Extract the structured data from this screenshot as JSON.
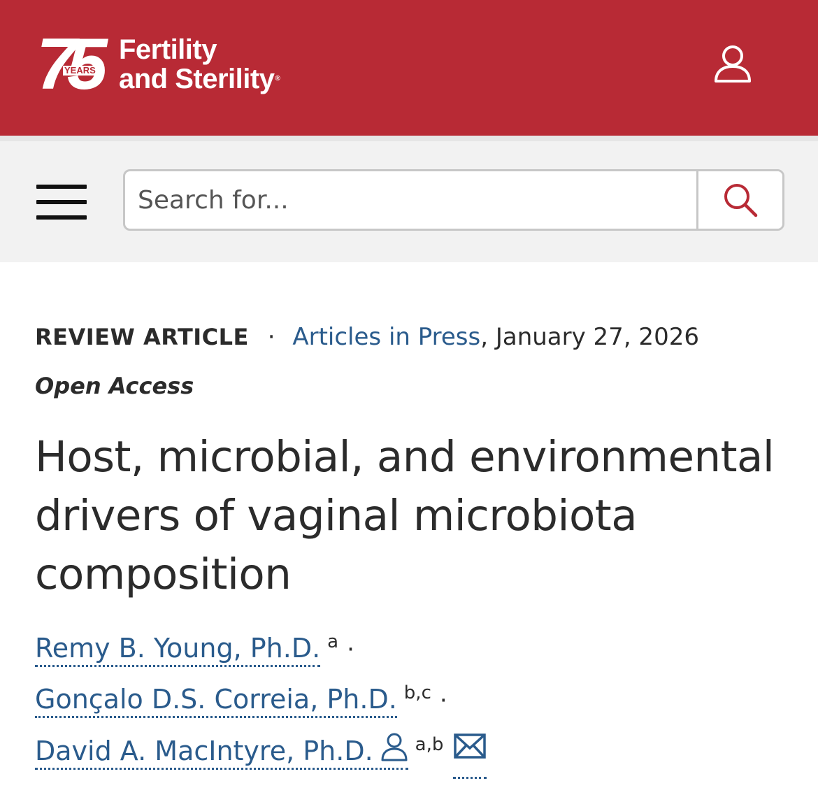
{
  "header": {
    "logo_number": "75",
    "logo_years": "YEARS",
    "journal_line1": "Fertility",
    "journal_line2": "and Sterility",
    "trademark": "®",
    "brand_color": "#b82a35"
  },
  "search": {
    "placeholder": "Search for..."
  },
  "article": {
    "type": "REVIEW ARTICLE",
    "separator": "·",
    "issue_link": "Articles in Press",
    "date": ", January 27, 2026",
    "access": "Open Access",
    "title": "Host, microbial, and environmental drivers of vaginal microbiota composition",
    "authors": [
      {
        "name": "Remy B. Young, Ph.D.",
        "affiliations": "a",
        "separator": "·"
      },
      {
        "name": "Gonçalo D.S. Correia, Ph.D.",
        "affiliations": "b,c",
        "separator": "·"
      },
      {
        "name": "David A. MacIntyre, Ph.D.",
        "affiliations": "a,b",
        "corresponding": true
      }
    ]
  },
  "icons": {
    "account": "user-icon",
    "menu": "hamburger-menu-icon",
    "search": "search-icon",
    "corresponding": "person-icon",
    "email": "envelope-icon"
  },
  "colors": {
    "link": "#2a5b8c",
    "search_icon": "#b82a35"
  }
}
